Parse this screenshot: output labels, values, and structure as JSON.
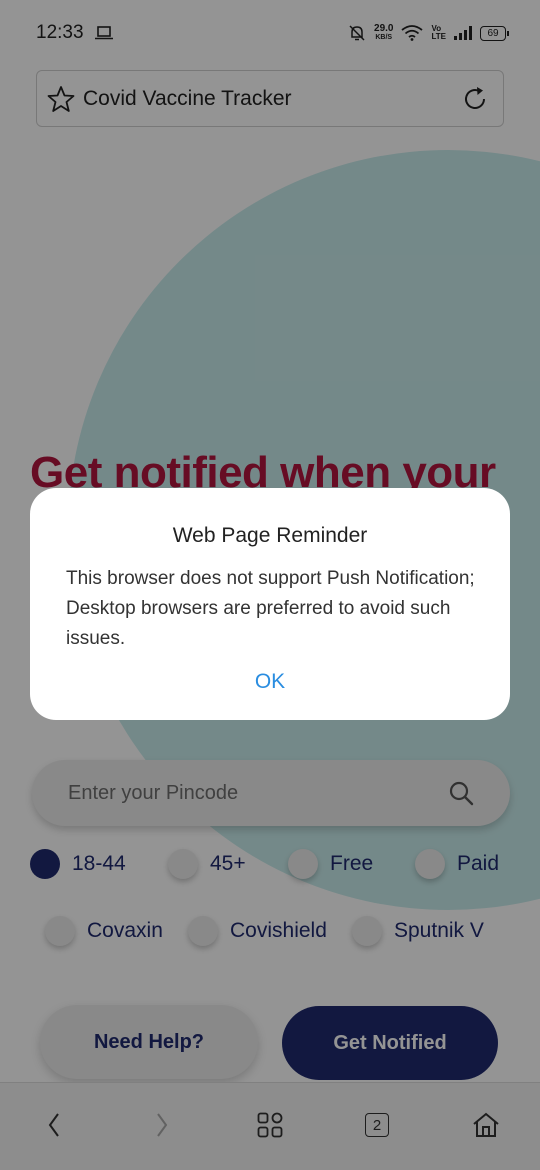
{
  "status_bar": {
    "time": "12:33",
    "net_speed": "29.0",
    "net_unit": "KB/S",
    "volte": "Vo\nLTE",
    "battery": "69"
  },
  "browser": {
    "page_title": "Covid Vaccine Tracker"
  },
  "page": {
    "hero_heading": "Get notified when your",
    "pincode_placeholder": "Enter your Pincode",
    "age_filters": [
      {
        "label": "18-44",
        "selected": true
      },
      {
        "label": "45+",
        "selected": false
      },
      {
        "label": "Free",
        "selected": false
      },
      {
        "label": "Paid",
        "selected": false
      }
    ],
    "vaccine_filters": [
      {
        "label": "Covaxin",
        "selected": false
      },
      {
        "label": "Covishield",
        "selected": false
      },
      {
        "label": "Sputnik V",
        "selected": false
      }
    ],
    "help_button": "Need Help?",
    "notify_button": "Get Notified"
  },
  "dialog": {
    "title": "Web Page Reminder",
    "message": "This browser does not support Push Notification; Desktop browsers are preferred to avoid such issues.",
    "ok_label": "OK"
  },
  "bottom_nav": {
    "tab_count": "2"
  },
  "colors": {
    "brand_navy": "#1f2a6e",
    "heading_red": "#b2163e",
    "hero_teal": "#c9ecec",
    "link_blue": "#2a8de0"
  }
}
